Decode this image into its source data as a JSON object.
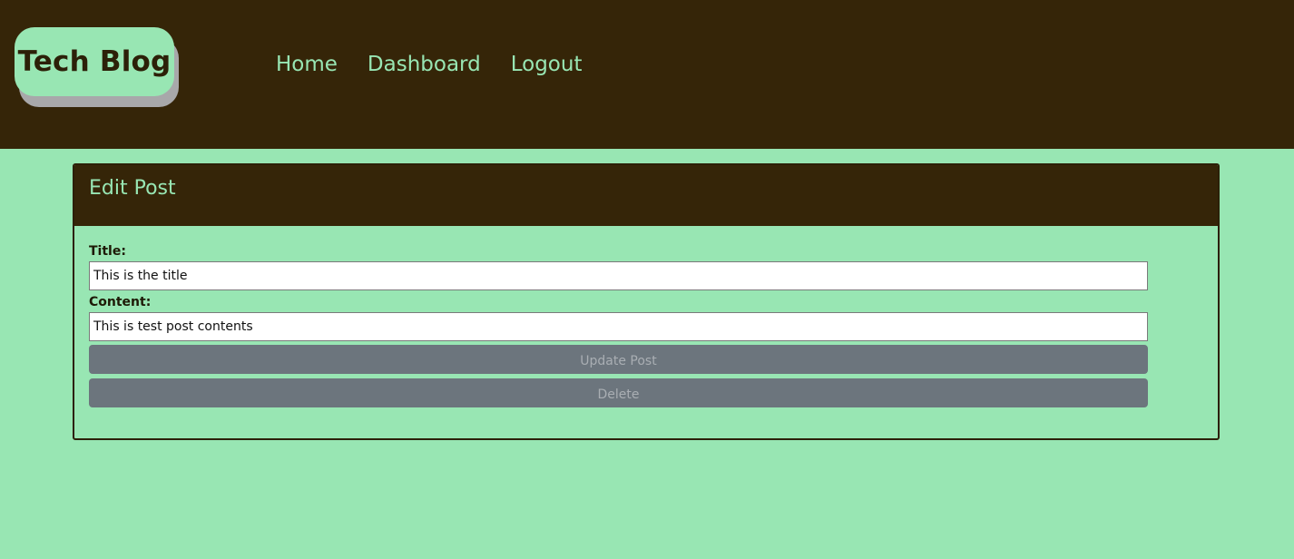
{
  "header": {
    "logo_text": "Tech Blog",
    "nav": {
      "home": "Home",
      "dashboard": "Dashboard",
      "logout": "Logout"
    }
  },
  "edit_post": {
    "title": "Edit Post",
    "title_label": "Title:",
    "title_value": "This is the title",
    "content_label": "Content:",
    "content_value": "This is test post contents",
    "update_button": "Update Post",
    "delete_button": "Delete"
  },
  "colors": {
    "page_background": "#98e6b3",
    "header_background": "#352508",
    "button_background": "#6c757d"
  }
}
